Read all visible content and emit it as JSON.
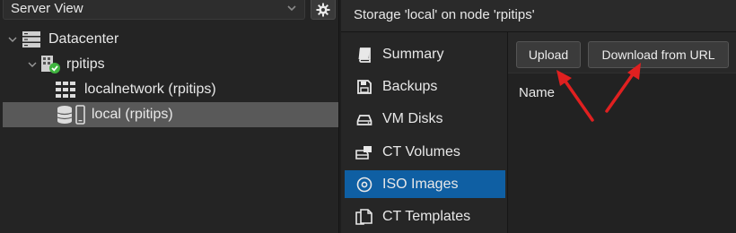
{
  "tree": {
    "view_select": "Server View",
    "nodes": [
      {
        "label": "Datacenter"
      },
      {
        "label": "rpitips"
      },
      {
        "label": "localnetwork (rpitips)"
      },
      {
        "label": "local (rpitips)"
      }
    ]
  },
  "header": {
    "title": "Storage 'local' on node 'rpitips'"
  },
  "subnav": {
    "items": [
      {
        "label": "Summary",
        "icon": "book-icon"
      },
      {
        "label": "Backups",
        "icon": "floppy-disk-icon"
      },
      {
        "label": "VM Disks",
        "icon": "hard-drive-icon"
      },
      {
        "label": "CT Volumes",
        "icon": "container-volume-icon"
      },
      {
        "label": "ISO Images",
        "icon": "disc-icon"
      },
      {
        "label": "CT Templates",
        "icon": "template-icon"
      }
    ],
    "active_label": "ISO Images"
  },
  "toolbar": {
    "upload_label": "Upload",
    "download_label": "Download from URL"
  },
  "table": {
    "columns": [
      "Name"
    ]
  },
  "colors": {
    "active_nav": "#0f5fa3",
    "selected_row": "#595959",
    "annotation_arrow": "#e02020",
    "status_ok": "#3fb43f"
  }
}
